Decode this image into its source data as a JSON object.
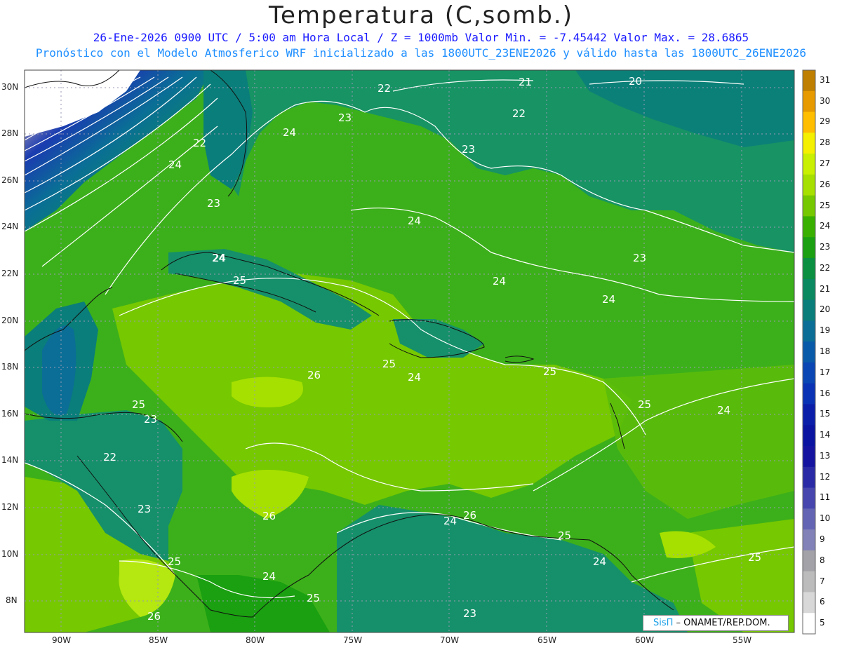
{
  "title": "Temperatura (C,somb.)",
  "subtitle_line1": "26-Ene-2026  0900 UTC / 5:00 am Hora Local / Z = 1000mb  Valor Min. = -7.45442  Valor Max. = 28.6865",
  "subtitle_line2": "Pronóstico con el Modelo Atmosferico WRF inicializado a las 1800UTC_23ENE2026 y válido hasta las  1800UTC_26ENE2026",
  "credit": {
    "brand": "SisΠ",
    "org": " – ONAMET/REP.DOM."
  },
  "lat_labels": [
    "30N",
    "28N",
    "26N",
    "24N",
    "22N",
    "20N",
    "18N",
    "16N",
    "14N",
    "12N",
    "10N",
    "8N"
  ],
  "lon_labels": [
    "90W",
    "85W",
    "80W",
    "75W",
    "70W",
    "65W",
    "60W",
    "55W"
  ],
  "colorbar_labels": [
    "31",
    "30",
    "29",
    "28",
    "27",
    "26",
    "25",
    "24",
    "23",
    "22",
    "21",
    "20",
    "19",
    "18",
    "17",
    "16",
    "15",
    "14",
    "13",
    "12",
    "11",
    "10",
    "9",
    "8",
    "7",
    "6",
    "5"
  ],
  "colorbar_colors": [
    "#bf7f00",
    "#e69a00",
    "#ffbf00",
    "#f4f000",
    "#c8f000",
    "#a6e000",
    "#76c800",
    "#39b000",
    "#1aa010",
    "#0a9040",
    "#0a8860",
    "#0a7e7a",
    "#0a6e96",
    "#0a5aaa",
    "#0a46b4",
    "#0a32b4",
    "#0a1eaa",
    "#0a14a0",
    "#1414a0",
    "#2a2aa6",
    "#4646ae",
    "#6464b4",
    "#8282b8",
    "#a2a2a8",
    "#bcbcbc",
    "#d8d8d8",
    "#ffffff"
  ],
  "contour_labels": [
    "20",
    "21",
    "22",
    "22",
    "23",
    "23",
    "24",
    "24",
    "22",
    "24",
    "23",
    "24",
    "25",
    "24",
    "23",
    "24",
    "24",
    "26",
    "25",
    "24",
    "25",
    "25",
    "24",
    "25",
    "23",
    "22",
    "23",
    "26",
    "24",
    "26",
    "25",
    "24",
    "24",
    "25",
    "23",
    "25",
    "26",
    "25"
  ],
  "map_colors": {
    "warm_land": "#90d020",
    "sea_green": "#3cb01a",
    "cool_sea": "#15906a",
    "deep_blue": "#0a5aaa"
  }
}
